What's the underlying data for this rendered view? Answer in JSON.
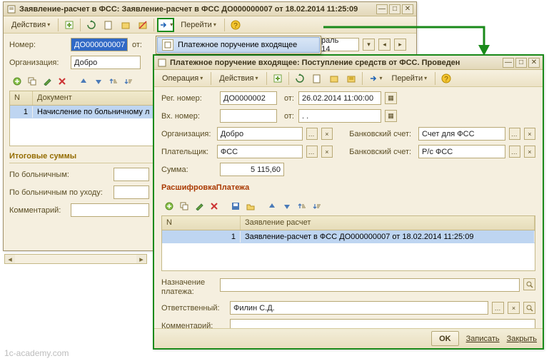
{
  "window1": {
    "title": "Заявление-расчет в ФСС: Заявление-расчет в ФСС ДО000000007 от 18.02.2014 11:25:09",
    "actions_label": "Действия",
    "goto_label": "Перейти",
    "number_label": "Номер:",
    "number_value": "ДО000000007",
    "from_label": "от:",
    "period_value": "евраль 2014",
    "org_label": "Организация:",
    "org_value": "Добро",
    "grid": {
      "col_n": "N",
      "col_doc": "Документ",
      "row_n": "1",
      "row_doc": "Начисление по больничному л"
    },
    "totals_title": "Итоговые суммы",
    "by_sick_label": "По больничным:",
    "by_sick_care_label": "По больничным по уходу:",
    "comment_label": "Комментарий:"
  },
  "popup": {
    "item1": "Платежное поручение входящее"
  },
  "window2": {
    "title": "Платежное поручение входящее: Поступление средств от ФСС. Проведен",
    "operation_label": "Операция",
    "actions_label": "Действия",
    "goto_label": "Перейти",
    "reg_no_label": "Рег. номер:",
    "reg_no_value": "ДО0000002",
    "from_label": "от:",
    "date_value": "26.02.2014 11:00:00",
    "in_no_label": "Вх. номер:",
    "in_from_label": "от:",
    "in_date_value": ". .",
    "org_label": "Организация:",
    "org_value": "Добро",
    "bank_acc1_label": "Банковский счет:",
    "bank_acc1_value": "Счет для ФСС",
    "payer_label": "Плательщик:",
    "payer_value": "ФСС",
    "bank_acc2_label": "Банковский счет:",
    "bank_acc2_value": "Р/с  ФСС",
    "sum_label": "Сумма:",
    "sum_value": "5 115,60",
    "details_title": "РасшифровкаПлатежа",
    "grid": {
      "col_n": "N",
      "col_app": "Заявление расчет",
      "row_n": "1",
      "row_app": "Заявление-расчет в ФСС ДО000000007 от 18.02.2014 11:25:09"
    },
    "purpose_label": "Назначение платежа:",
    "responsible_label": "Ответственный:",
    "responsible_value": "Филин С.Д.",
    "comment_label": "Комментарий:",
    "btn_ok": "OK",
    "btn_write": "Записать",
    "btn_close": "Закрыть"
  },
  "watermark": "1c-academy.com"
}
